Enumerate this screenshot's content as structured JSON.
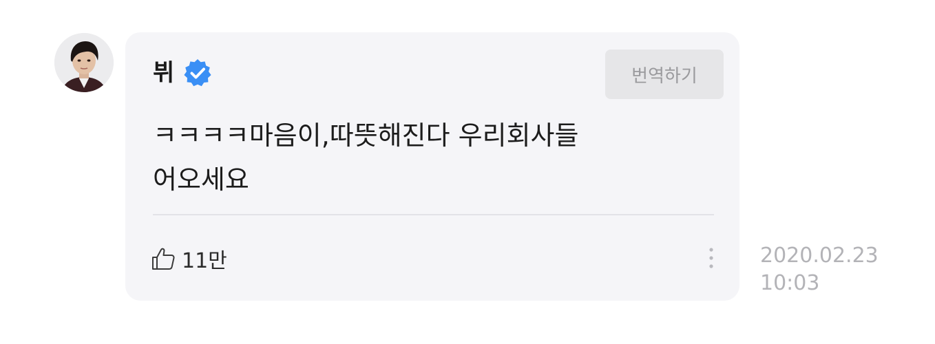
{
  "comment": {
    "author": "뷔",
    "translate_label": "번역하기",
    "message": "ㅋㅋㅋㅋ마음이,따뜻해진다 우리회사들\n어오세요",
    "likes": "11만",
    "date": "2020.02.23",
    "time": "10:03"
  },
  "icons": {
    "verified": "verified-badge-icon",
    "like": "thumbs-up-icon",
    "more": "more-vertical-icon"
  },
  "colors": {
    "card_bg": "#f5f5f8",
    "verified": "#3a8ff5",
    "translate_bg": "#e6e6e8",
    "translate_text": "#9a9a9d",
    "timestamp": "#b3b3b7"
  }
}
